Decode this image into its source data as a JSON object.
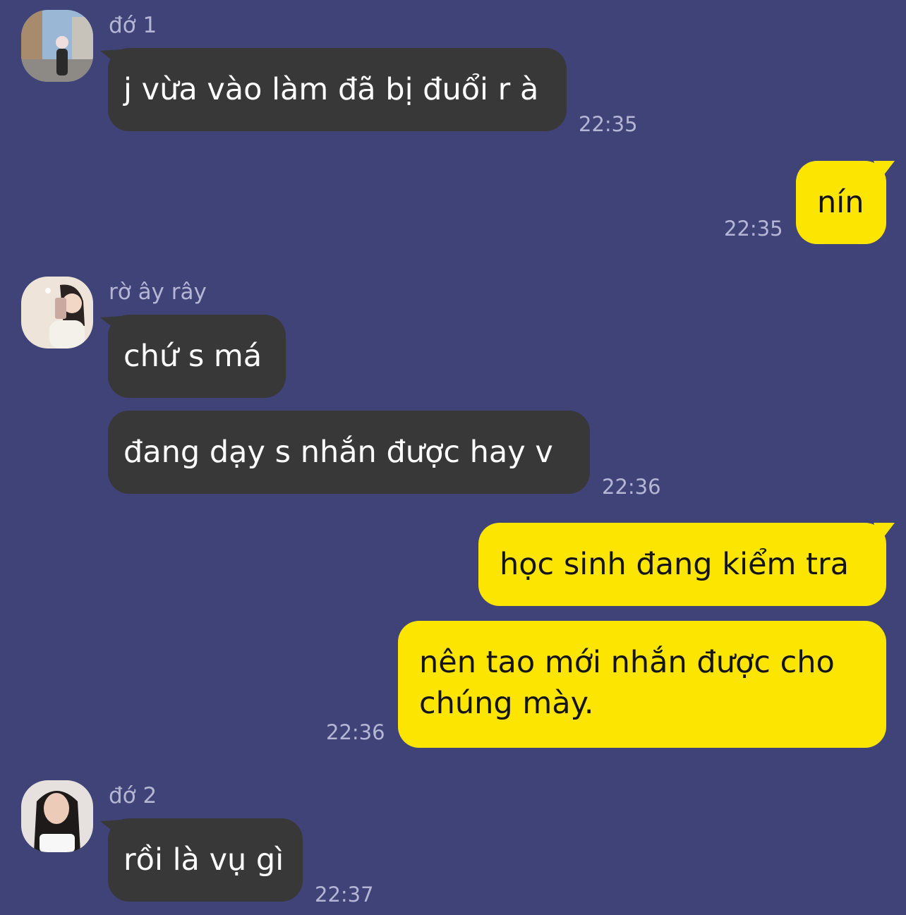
{
  "colors": {
    "background": "#404378",
    "incoming_bubble": "#383838",
    "outgoing_bubble": "#fde502",
    "meta_text": "#b4b6d4"
  },
  "messages": [
    {
      "sender": "đớ 1",
      "text": "j vừa vào làm đã bị đuổi r à",
      "time": "22:35"
    },
    {
      "text": "nín",
      "time": "22:35"
    },
    {
      "sender": "rờ ây rây",
      "text": "chứ s má"
    },
    {
      "text": "đang dạy s nhắn được hay v",
      "time": "22:36"
    },
    {
      "text": "học sinh đang kiểm tra"
    },
    {
      "text": "nên tao mới nhắn được cho chúng mày.",
      "time": "22:36"
    },
    {
      "sender": "đớ 2",
      "text": "rồi là vụ gì",
      "time": "22:37"
    }
  ]
}
